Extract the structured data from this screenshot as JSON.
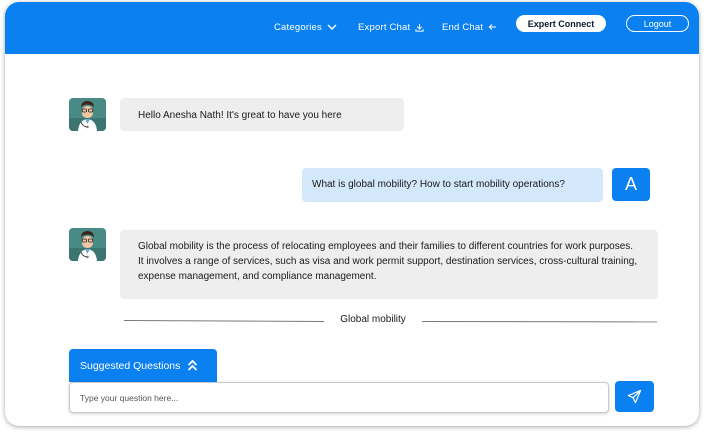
{
  "header": {
    "nav": {
      "categories": "Categories",
      "export_chat": "Export Chat",
      "end_chat": "End Chat"
    },
    "expert_connect": "Expert Connect",
    "logout": "Logout"
  },
  "chat": {
    "bot_greeting": "Hello Anesha Nath! It's great to have you here",
    "user_question": "What is global mobility? How to start mobility operations?",
    "user_initial": "A",
    "bot_answer": "Global mobility is the process of relocating employees and their families to different countries for work purposes. It involves a range of services, such as visa and work permit support, destination services, cross-cultural training, expense management, and compliance management."
  },
  "topic_divider": "Global mobility",
  "suggested_questions": {
    "label": "Suggested Questions"
  },
  "input": {
    "placeholder": "Type your question here...",
    "value": ""
  },
  "icons": {
    "categories": "chevron-down-icon",
    "export": "download-icon",
    "end_chat": "arrow-left-icon",
    "suggested": "double-chevron-up-icon",
    "send": "paper-plane-icon",
    "bot_avatar": "doctor-avatar"
  },
  "colors": {
    "brand": "#0b80f0",
    "bot_bubble": "#eeeeee",
    "user_bubble": "#d3e8fb"
  }
}
